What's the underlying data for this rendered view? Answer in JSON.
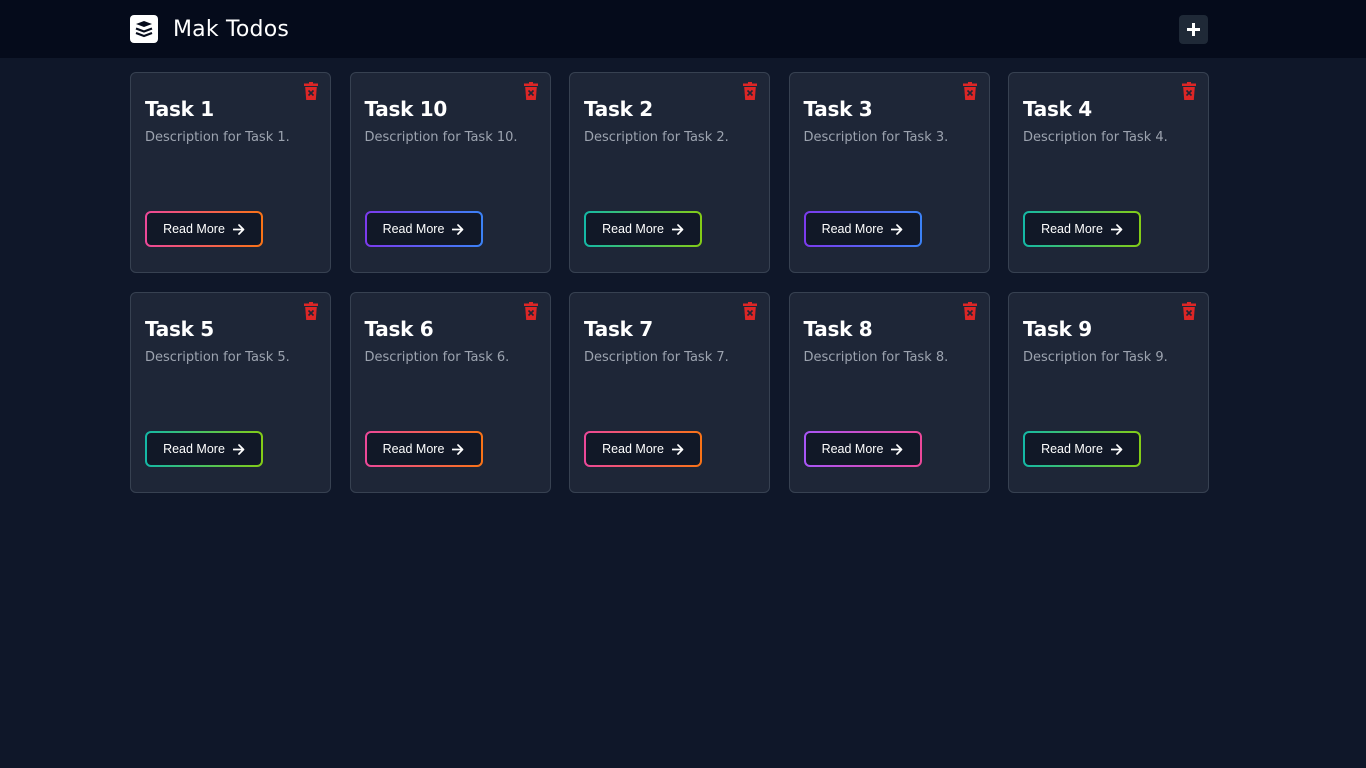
{
  "app": {
    "title": "Mak Todos"
  },
  "header": {
    "logo_icon": "stack-layers-icon",
    "add_icon": "plus-icon"
  },
  "tasks": [
    {
      "title": "Task 1",
      "description": "Description for Task 1.",
      "button_label": "Read More",
      "accent": "orange"
    },
    {
      "title": "Task 10",
      "description": "Description for Task 10.",
      "button_label": "Read More",
      "accent": "blue"
    },
    {
      "title": "Task 2",
      "description": "Description for Task 2.",
      "button_label": "Read More",
      "accent": "green"
    },
    {
      "title": "Task 3",
      "description": "Description for Task 3.",
      "button_label": "Read More",
      "accent": "blue"
    },
    {
      "title": "Task 4",
      "description": "Description for Task 4.",
      "button_label": "Read More",
      "accent": "green"
    },
    {
      "title": "Task 5",
      "description": "Description for Task 5.",
      "button_label": "Read More",
      "accent": "green"
    },
    {
      "title": "Task 6",
      "description": "Description for Task 6.",
      "button_label": "Read More",
      "accent": "orange"
    },
    {
      "title": "Task 7",
      "description": "Description for Task 7.",
      "button_label": "Read More",
      "accent": "orange"
    },
    {
      "title": "Task 8",
      "description": "Description for Task 8.",
      "button_label": "Read More",
      "accent": "purple"
    },
    {
      "title": "Task 9",
      "description": "Description for Task 9.",
      "button_label": "Read More",
      "accent": "green"
    }
  ],
  "colors": {
    "background": "#0f1729",
    "header": "#050b1b",
    "card": "#1e2637",
    "delete": "#dc2626"
  }
}
